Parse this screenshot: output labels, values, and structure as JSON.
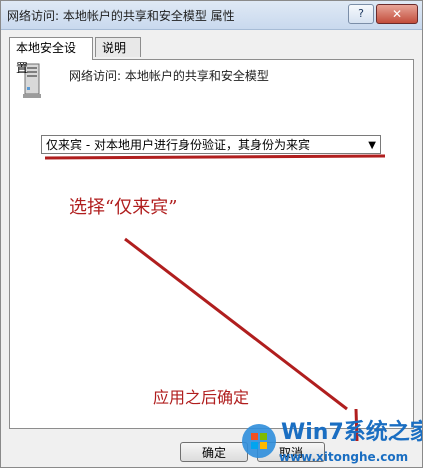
{
  "window": {
    "title": "网络访问: 本地帐户的共享和安全模型 属性",
    "help_label": "?",
    "close_label": "✕"
  },
  "tabs": [
    {
      "label": "本地安全设置"
    },
    {
      "label": "说明"
    }
  ],
  "panel": {
    "policy_icon": "server-icon",
    "policy_name": "网络访问: 本地帐户的共享和安全模型",
    "select_value": "仅来宾 - 对本地用户进行身份验证，其身份为来宾"
  },
  "annotations": {
    "step1": "选择“仅来宾”",
    "step2": "应用之后确定",
    "color": "#b01e1e"
  },
  "buttons": {
    "ok": "确定",
    "cancel": "取消"
  },
  "watermark": {
    "brand_text": "Win7系统之家",
    "url_text": "www.xitonghe.com"
  }
}
